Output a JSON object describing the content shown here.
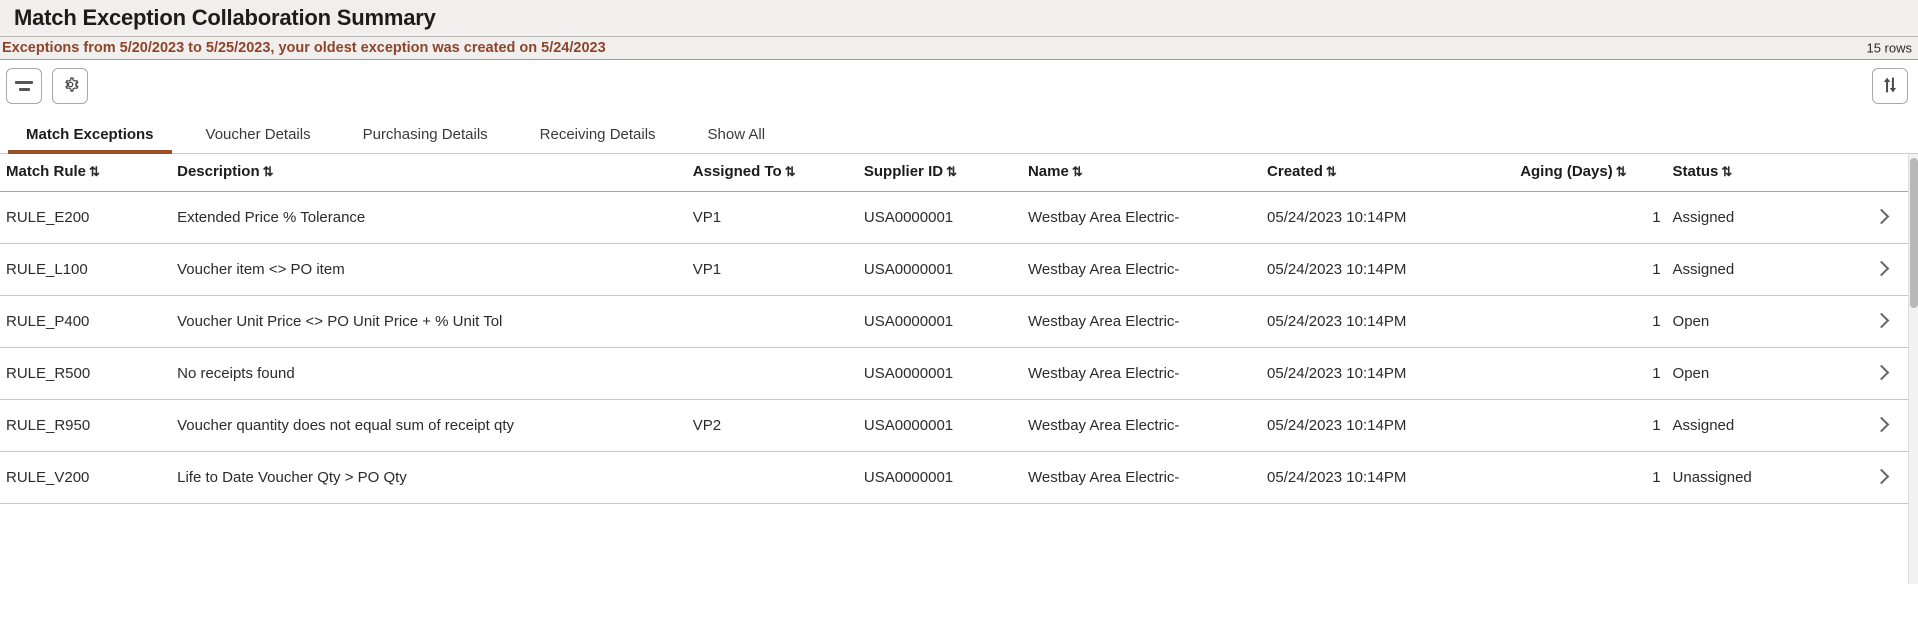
{
  "header": {
    "title": "Match Exception Collaboration Summary"
  },
  "subtitle": {
    "message": "Exceptions from 5/20/2023 to 5/25/2023, your oldest exception was created on 5/24/2023",
    "rows_count": "15 rows",
    "accent_color": "#8c452a"
  },
  "toolbar": {
    "filter_icon": "filter-icon",
    "settings_icon": "gear-icon",
    "sort_icon": "sort-updown-icon"
  },
  "tabs": [
    {
      "label": "Match Exceptions",
      "active": true
    },
    {
      "label": "Voucher Details",
      "active": false
    },
    {
      "label": "Purchasing Details",
      "active": false
    },
    {
      "label": "Receiving Details",
      "active": false
    },
    {
      "label": "Show All",
      "active": false
    }
  ],
  "table": {
    "sort_glyph": "⇅",
    "columns": [
      {
        "key": "match_rule",
        "label": "Match Rule",
        "sortable": true
      },
      {
        "key": "description",
        "label": "Description",
        "sortable": true
      },
      {
        "key": "assigned_to",
        "label": "Assigned To",
        "sortable": true
      },
      {
        "key": "supplier_id",
        "label": "Supplier ID",
        "sortable": true
      },
      {
        "key": "name",
        "label": "Name",
        "sortable": true
      },
      {
        "key": "created",
        "label": "Created",
        "sortable": true
      },
      {
        "key": "aging_days",
        "label": "Aging (Days)",
        "sortable": true
      },
      {
        "key": "status",
        "label": "Status",
        "sortable": true
      }
    ],
    "rows": [
      {
        "match_rule": "RULE_E200",
        "description": "Extended Price % Tolerance",
        "assigned_to": "VP1",
        "supplier_id": "USA0000001",
        "name": "Westbay Area Electric-",
        "created": "05/24/2023 10:14PM",
        "aging_days": "1",
        "status": "Assigned"
      },
      {
        "match_rule": "RULE_L100",
        "description": "Voucher item <> PO item",
        "assigned_to": "VP1",
        "supplier_id": "USA0000001",
        "name": "Westbay Area Electric-",
        "created": "05/24/2023 10:14PM",
        "aging_days": "1",
        "status": "Assigned"
      },
      {
        "match_rule": "RULE_P400",
        "description": "Voucher Unit Price <> PO Unit Price + % Unit Tol",
        "assigned_to": "",
        "supplier_id": "USA0000001",
        "name": "Westbay Area Electric-",
        "created": "05/24/2023 10:14PM",
        "aging_days": "1",
        "status": "Open"
      },
      {
        "match_rule": "RULE_R500",
        "description": "No receipts found",
        "assigned_to": "",
        "supplier_id": "USA0000001",
        "name": "Westbay Area Electric-",
        "created": "05/24/2023 10:14PM",
        "aging_days": "1",
        "status": "Open"
      },
      {
        "match_rule": "RULE_R950",
        "description": "Voucher quantity does not equal sum of receipt qty",
        "assigned_to": "VP2",
        "supplier_id": "USA0000001",
        "name": "Westbay Area Electric-",
        "created": "05/24/2023 10:14PM",
        "aging_days": "1",
        "status": "Assigned"
      },
      {
        "match_rule": "RULE_V200",
        "description": "Life to Date Voucher Qty > PO Qty",
        "assigned_to": "",
        "supplier_id": "USA0000001",
        "name": "Westbay Area Electric-",
        "created": "05/24/2023 10:14PM",
        "aging_days": "1",
        "status": "Unassigned"
      }
    ]
  }
}
